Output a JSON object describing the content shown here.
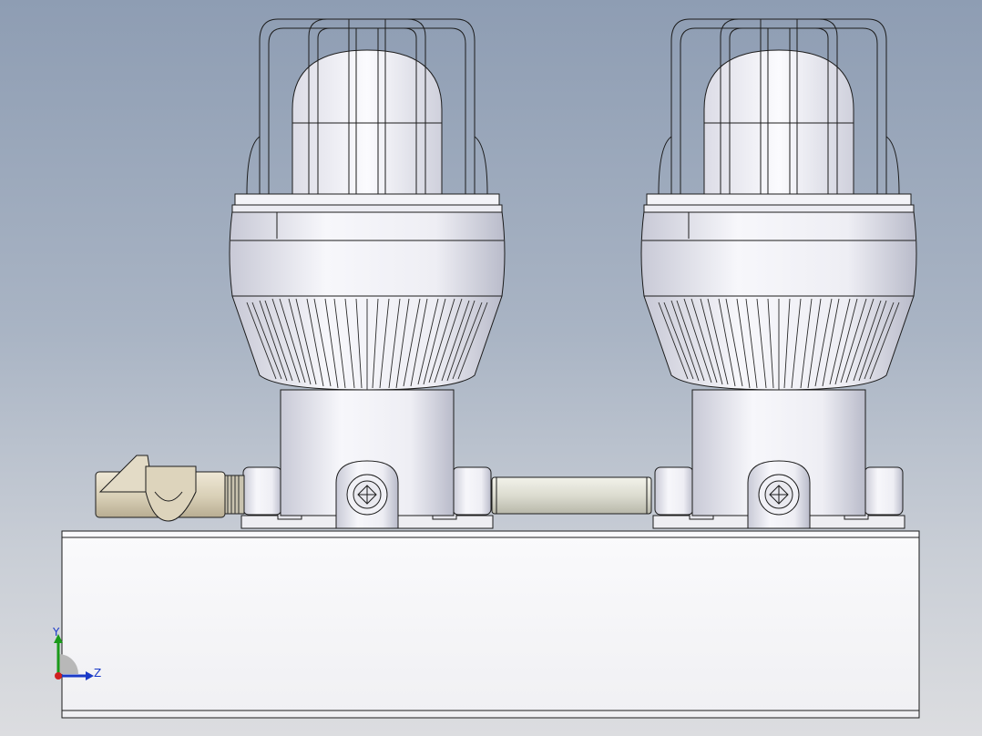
{
  "viewport": {
    "background_top": "#8e9db3",
    "background_bottom": "#dcdde0"
  },
  "model": {
    "lamp_count": 2,
    "body_color": "#f4f4f8",
    "edge_color": "#1c1c1c",
    "fitting_color": "#d8cfb8"
  },
  "triad": {
    "y_label": "Y",
    "z_label": "Z",
    "y_color": "#1a9a1a",
    "z_color": "#1a3ac8",
    "x_color": "#d02020"
  }
}
